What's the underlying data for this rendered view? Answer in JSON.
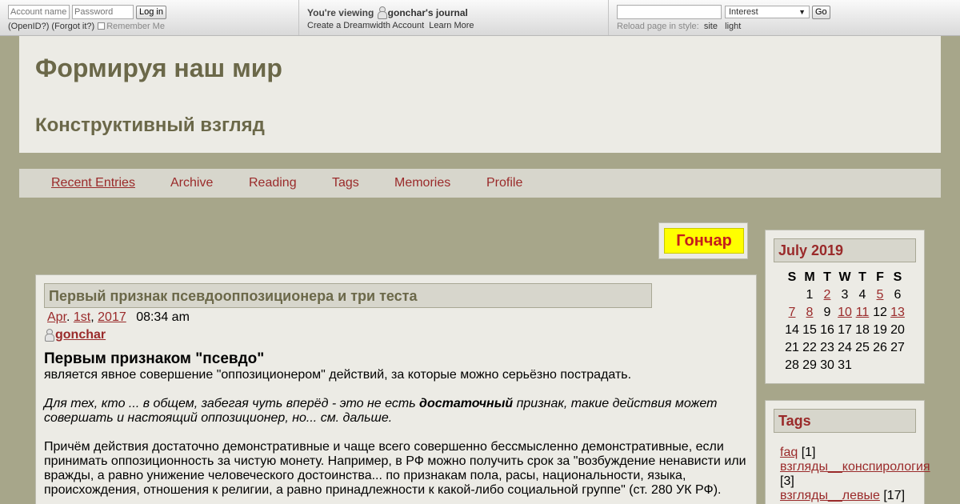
{
  "topbar": {
    "account_placeholder": "Account name:",
    "password_placeholder": "Password",
    "login_label": "Log in",
    "openid_label": "(OpenID?)",
    "forgot_label": "(Forgot it?)",
    "remember_label": "Remember Me",
    "viewing_prefix": "You're viewing",
    "viewing_user": "gonchar's journal",
    "create_account": "Create a Dreamwidth Account",
    "learn_more": "Learn More",
    "search_value": "",
    "search_select": "Interest",
    "go_label": "Go",
    "reload_label": "Reload page in style:",
    "style_site": "site",
    "style_light": "light"
  },
  "header": {
    "title": "Формируя наш мир",
    "subtitle": "Конструктивный взгляд"
  },
  "nav": {
    "items": [
      "Recent Entries",
      "Archive",
      "Reading",
      "Tags",
      "Memories",
      "Profile"
    ]
  },
  "banner": {
    "text": "Гончар",
    "bg_color": "#ffff00",
    "text_color": "#c41c1c"
  },
  "entry": {
    "subject": "Первый признак псевдооппозиционера и три теста",
    "date_month": "Apr",
    "date_day": "1st",
    "date_year": "2017",
    "time": "08:34 am",
    "poster": "gonchar",
    "heading": "Первым признаком \"псевдо\"",
    "p1": "является явное совершение \"оппозиционером\" действий, за которые можно серьёзно пострадать.",
    "p2_before": "Для тех, кто ... в общем, забегая чуть вперёд - это не есть ",
    "p2_bold": "достаточный",
    "p2_after": " признак, такие действия может совершать и настоящий оппозиционер, но... см. дальше.",
    "p3": "Причём действия достаточно демонстративные и чаще всего совершенно бессмысленно демонстративные, если принимать оппозиционность за чистую монету. Например, в РФ можно получить срок за \"возбуждение ненависти или вражды, а равно унижение человеческого достоинства... по признакам пола, расы, национальности, языка, происхождения, отношения к религии, а равно принадлежности к какой-либо социальной группе\" (ст. 280 УК РФ)."
  },
  "calendar": {
    "title": "July 2019",
    "weekdays": [
      "S",
      "M",
      "T",
      "W",
      "T",
      "F",
      "S"
    ],
    "rows": [
      [
        "",
        "1",
        "2",
        "3",
        "4",
        "5",
        "6"
      ],
      [
        "7",
        "8",
        "9",
        "10",
        "11",
        "12",
        "13"
      ],
      [
        "14",
        "15",
        "16",
        "17",
        "18",
        "19",
        "20"
      ],
      [
        "21",
        "22",
        "23",
        "24",
        "25",
        "26",
        "27"
      ],
      [
        "28",
        "29",
        "30",
        "31",
        "",
        "",
        ""
      ]
    ],
    "linked_days": [
      "2",
      "5",
      "7",
      "8",
      "10",
      "11",
      "13"
    ]
  },
  "tags": {
    "title": "Tags",
    "items": [
      {
        "name": "faq",
        "count": "[1]"
      },
      {
        "name": "взгляды__конспирология",
        "count": "[3]"
      },
      {
        "name": "взгляды__левые",
        "count": "[17]"
      }
    ]
  },
  "colors": {
    "background": "#a7a68a",
    "panel": "#ecebe5",
    "title_text": "#6b6849",
    "link": "#9a2a2a"
  }
}
